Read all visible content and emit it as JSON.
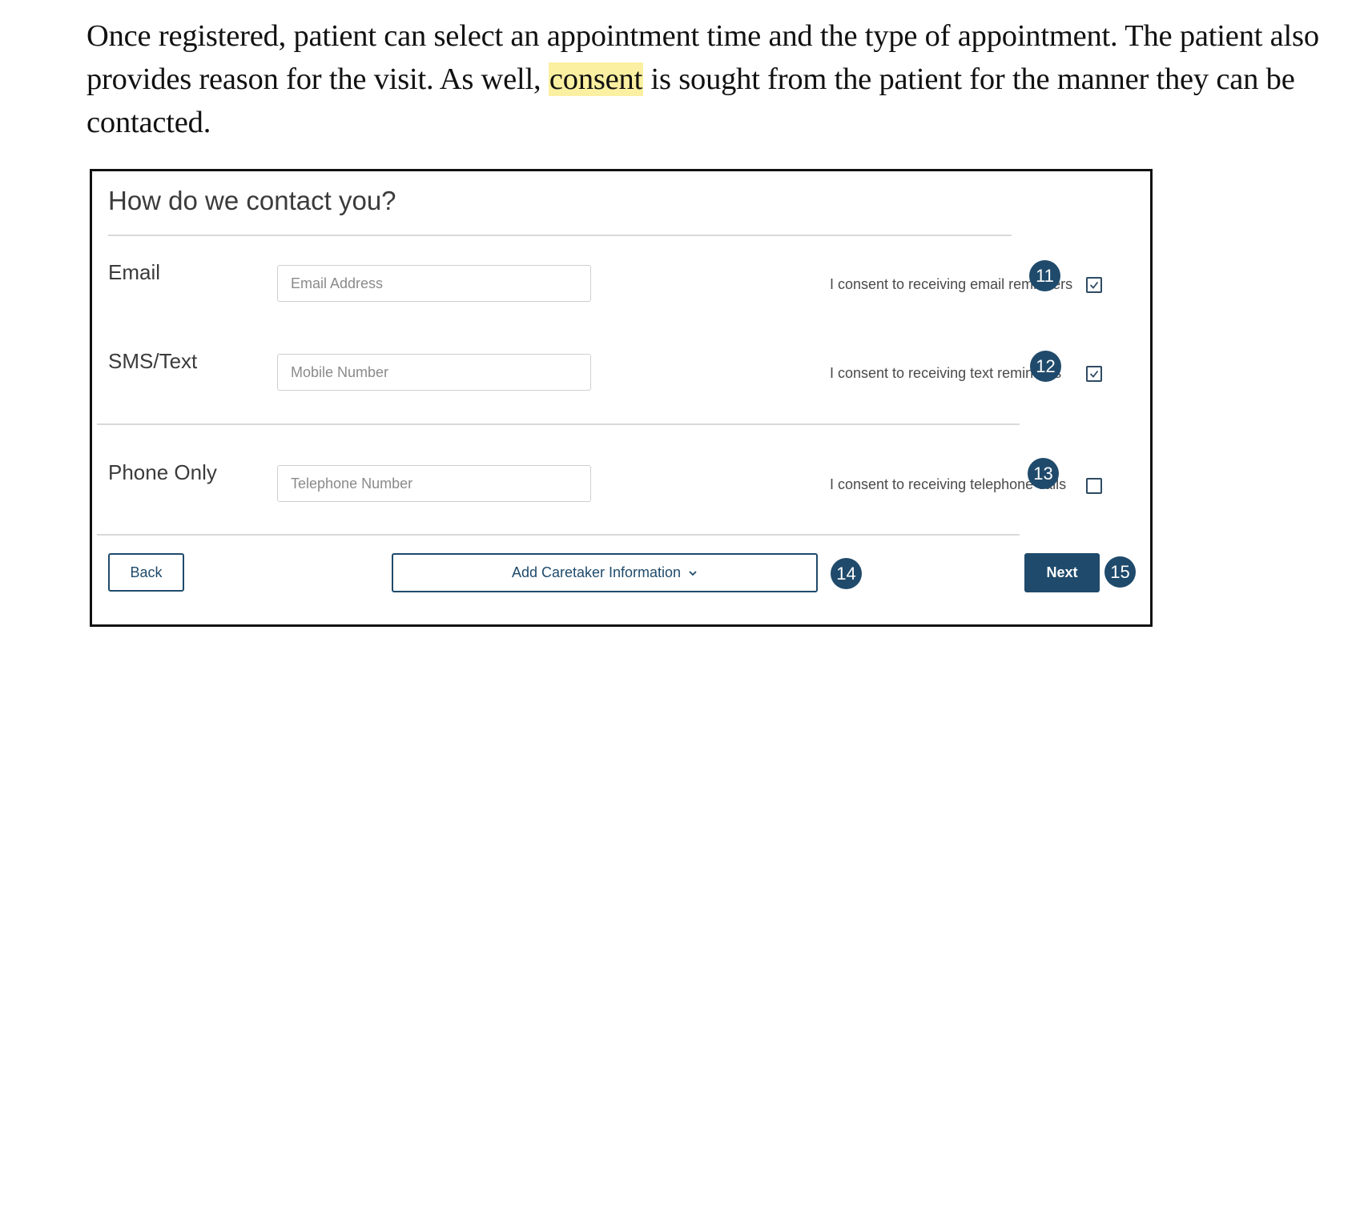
{
  "intro": {
    "part1": "Once registered, patient can select an appointment time and the type of appointment.  The patient also provides reason for the visit.  As well, ",
    "highlight": "consent",
    "part2": " is sought from the patient for the manner they can be contacted."
  },
  "form": {
    "title": "How do we contact you?",
    "rows": [
      {
        "label": "Email",
        "placeholder": "Email Address",
        "value": "",
        "consent": "I consent to receiving email reminders",
        "checked": true,
        "badge": "11"
      },
      {
        "label": "SMS/Text",
        "placeholder": "Mobile Number",
        "value": "",
        "consent": "I consent to receiving text reminders",
        "checked": true,
        "badge": "12"
      },
      {
        "label": "Phone Only",
        "placeholder": "Telephone Number",
        "value": "",
        "consent": "I consent to receiving telephone calls",
        "checked": false,
        "badge": "13"
      }
    ],
    "buttons": {
      "back": "Back",
      "caretaker": "Add Caretaker Information",
      "caretaker_badge": "14",
      "next": "Next",
      "next_badge": "15"
    }
  },
  "colors": {
    "brand": "#1f4a6b",
    "highlight": "#fbf0a1"
  }
}
